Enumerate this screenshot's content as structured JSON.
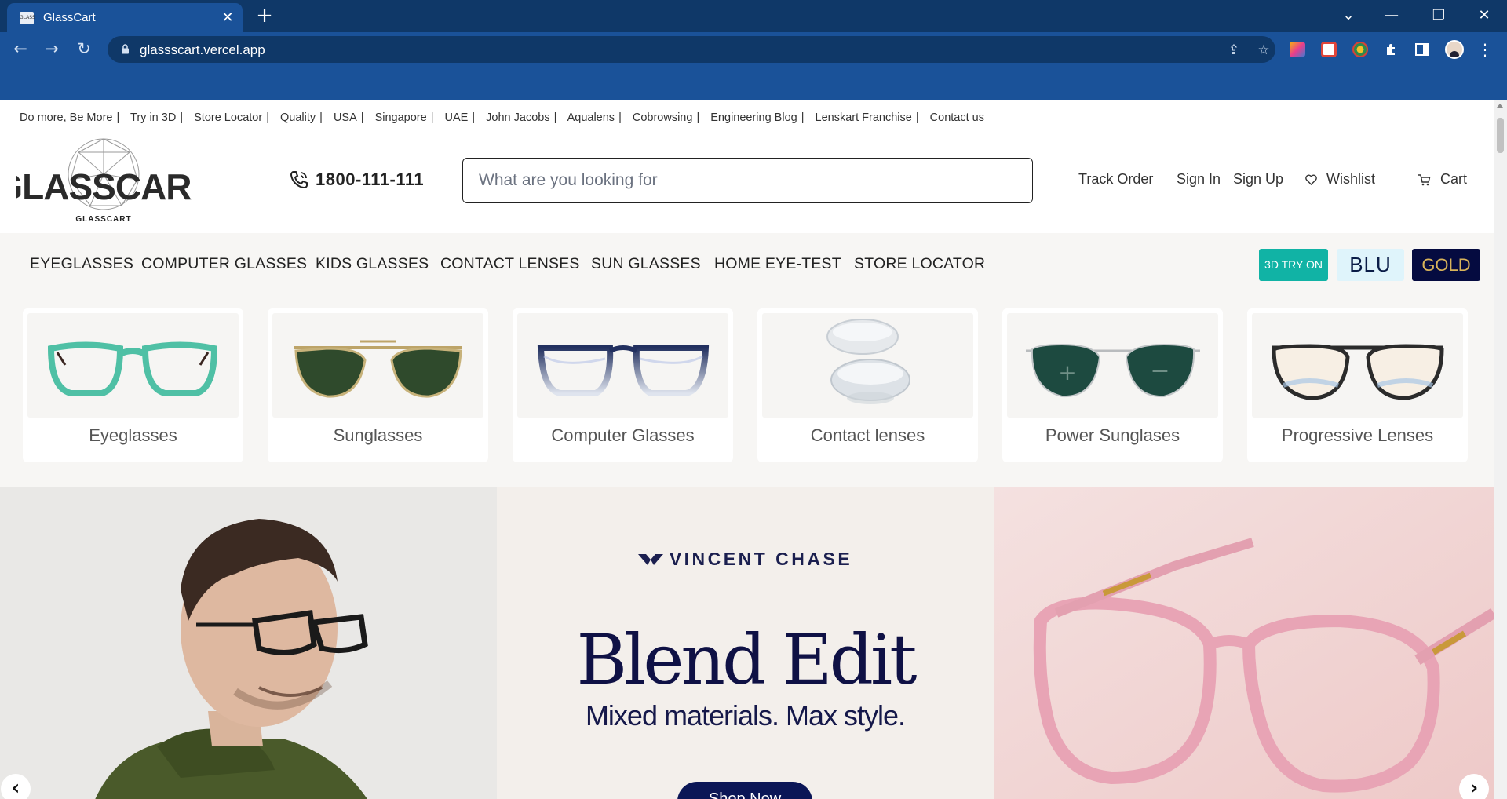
{
  "browser": {
    "tab_title": "GlassCart",
    "tab_favicon_text": "GLASS",
    "url": "glassscart.vercel.app",
    "close_symbol": "✕",
    "newtab_symbol": "+",
    "back_symbol": "←",
    "forward_symbol": "→",
    "reload_symbol": "↻",
    "tablist_symbol": "⌄",
    "minimize_symbol": "—",
    "restore_symbol": "❐",
    "window_close_symbol": "✕",
    "share_symbol": "⇪",
    "star_symbol": "☆",
    "menu_symbol": "⋮"
  },
  "top_links": [
    "Do more, Be More",
    "Try in 3D",
    "Store Locator",
    "Quality",
    "USA",
    "Singapore",
    "UAE",
    "John Jacobs",
    "Aqualens",
    "Cobrowsing",
    "Engineering Blog",
    "Lenskart Franchise",
    "Contact us"
  ],
  "separator": "|",
  "header": {
    "logo_text": "GLASSCART",
    "logo_subtext": "GLASSCART",
    "phone": "1800-111-111",
    "search_placeholder": "What are you looking for",
    "track_order": "Track Order",
    "sign_in": "Sign In",
    "sign_up": "Sign Up",
    "wishlist": "Wishlist",
    "cart": "Cart"
  },
  "menu": {
    "items": [
      "EYEGLASSES",
      "COMPUTER GLASSES",
      "KIDS GLASSES",
      "CONTACT LENSES",
      "SUN GLASSES",
      "HOME EYE-TEST",
      "STORE LOCATOR"
    ],
    "badge_3d": "3D TRY ON",
    "badge_blu": "BLU",
    "badge_gold": "GOLD"
  },
  "categories": [
    "Eyeglasses",
    "Sunglasses",
    "Computer Glasses",
    "Contact lenses",
    "Power Sunglases",
    "Progressive Lenses"
  ],
  "hero": {
    "brand": "VINCENT CHASE",
    "title": "Blend Edit",
    "subtitle": "Mixed materials. Max style.",
    "cta": "Shop Now",
    "prev_symbol": "‹",
    "next_symbol": "›"
  },
  "colors": {
    "chrome_dark": "#0f3868",
    "chrome_light": "#1a5299",
    "teal_badge": "#11b3a5",
    "gold_badge_bg": "#050b40",
    "gold_text": "#d9b45a",
    "hero_navy": "#0f1145"
  }
}
